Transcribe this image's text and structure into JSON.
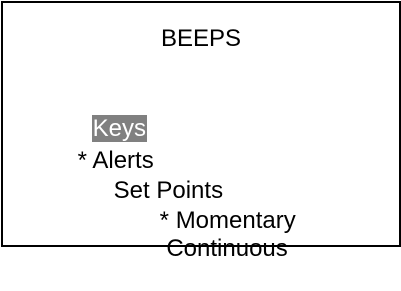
{
  "title": "BEEPS",
  "menu": {
    "keys": {
      "label": "Keys",
      "marker": ""
    },
    "alerts": {
      "label": "Alerts",
      "marker": "* "
    },
    "set_points": {
      "label": "Set Points",
      "marker": ""
    },
    "momentary": {
      "label": "Momentary",
      "marker": "* "
    },
    "continuous": {
      "label": "Continuous",
      "marker": " "
    }
  },
  "colors": {
    "highlight_background": "#808080",
    "highlight_text": "#ffffff",
    "text": "#000000",
    "border": "#000000",
    "background": "#ffffff"
  }
}
